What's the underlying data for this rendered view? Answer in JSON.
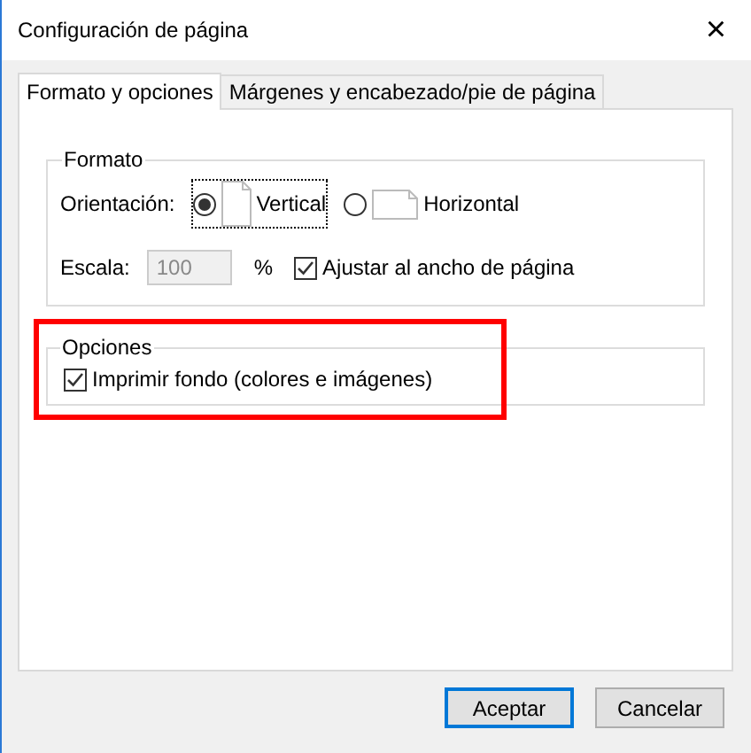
{
  "window": {
    "title": "Configuración de página",
    "close": "×"
  },
  "tabs": [
    {
      "label": "Formato y opciones",
      "selected": true
    },
    {
      "label": "Márgenes y encabezado/pie de página",
      "selected": false
    }
  ],
  "format_group": {
    "title": "Formato",
    "orientation_label": "Orientación:",
    "orientations": [
      {
        "label": "Vertical",
        "selected": true,
        "kind": "portrait"
      },
      {
        "label": "Horizontal",
        "selected": false,
        "kind": "landscape"
      }
    ],
    "scale_label": "Escala:",
    "scale_value": "100",
    "scale_disabled": true,
    "percent": "%",
    "fit_width": {
      "label": "Ajustar al ancho de página",
      "checked": true
    }
  },
  "options_group": {
    "title": "Opciones",
    "print_background": {
      "label": "Imprimir fondo (colores e imágenes)",
      "checked": true
    }
  },
  "buttons": [
    {
      "label": "Aceptar",
      "default": true
    },
    {
      "label": "Cancelar",
      "default": false
    }
  ]
}
